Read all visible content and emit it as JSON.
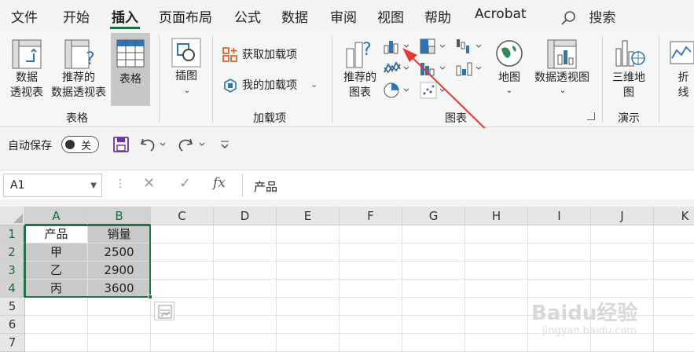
{
  "menu": {
    "tabs": [
      "文件",
      "开始",
      "插入",
      "页面布局",
      "公式",
      "数据",
      "审阅",
      "视图",
      "帮助",
      "Acrobat"
    ],
    "active": "插入",
    "search_label": "搜索"
  },
  "ribbon": {
    "tables": {
      "pivot": "数据\n透视表",
      "recommended_pivot": "推荐的\n数据透视表",
      "table": "表格",
      "group": "表格"
    },
    "illustrations": {
      "label": "插图"
    },
    "addins": {
      "get": "获取加载项",
      "mine": "我的加载项",
      "group": "加载项"
    },
    "charts": {
      "recommended": "推荐的\n图表",
      "map": "地图",
      "pivot_chart": "数据透视图",
      "group": "图表"
    },
    "tours": {
      "map3d": "三维地\n图",
      "group": "演示"
    },
    "sparklines": {
      "line": "折线"
    }
  },
  "qat": {
    "autosave_label": "自动保存",
    "autosave_state": "关"
  },
  "formula_bar": {
    "name_box": "A1",
    "fx": "fx",
    "value": "产品"
  },
  "sheet": {
    "columns": [
      "A",
      "B",
      "C",
      "D",
      "E",
      "F",
      "G",
      "H",
      "I",
      "J",
      "K"
    ],
    "rows": [
      "1",
      "2",
      "3",
      "4",
      "5",
      "6",
      "7"
    ],
    "data": [
      [
        "产品",
        "销量"
      ],
      [
        "甲",
        "2500"
      ],
      [
        "乙",
        "2900"
      ],
      [
        "丙",
        "3600"
      ]
    ]
  },
  "watermark": {
    "text": "Baidu经验",
    "url": "jingyan.baidu.com"
  },
  "colors": {
    "accent": "#217346",
    "arrow": "#e53935"
  }
}
